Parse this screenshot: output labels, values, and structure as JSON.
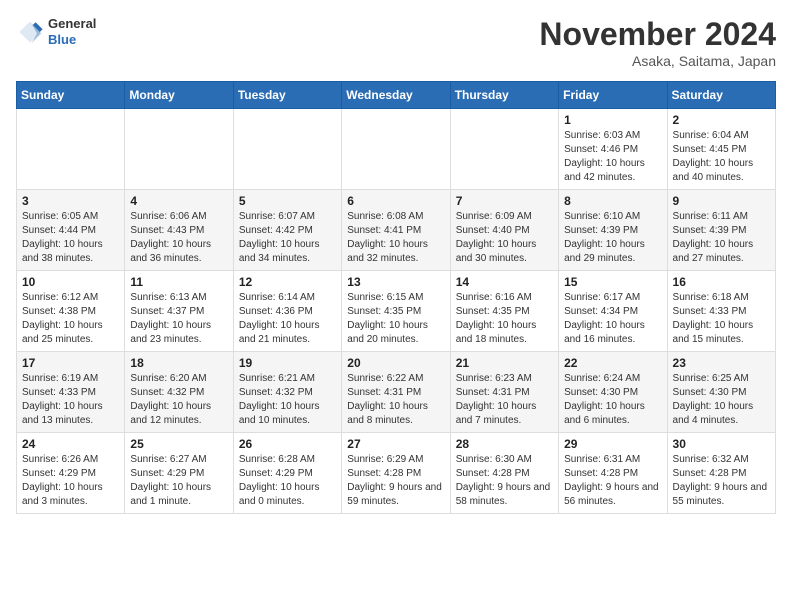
{
  "header": {
    "logo_general": "General",
    "logo_blue": "Blue",
    "month_title": "November 2024",
    "location": "Asaka, Saitama, Japan"
  },
  "days_of_week": [
    "Sunday",
    "Monday",
    "Tuesday",
    "Wednesday",
    "Thursday",
    "Friday",
    "Saturday"
  ],
  "weeks": [
    [
      {
        "day": "",
        "sunrise": "",
        "sunset": "",
        "daylight": ""
      },
      {
        "day": "",
        "sunrise": "",
        "sunset": "",
        "daylight": ""
      },
      {
        "day": "",
        "sunrise": "",
        "sunset": "",
        "daylight": ""
      },
      {
        "day": "",
        "sunrise": "",
        "sunset": "",
        "daylight": ""
      },
      {
        "day": "",
        "sunrise": "",
        "sunset": "",
        "daylight": ""
      },
      {
        "day": "1",
        "sunrise": "Sunrise: 6:03 AM",
        "sunset": "Sunset: 4:46 PM",
        "daylight": "Daylight: 10 hours and 42 minutes."
      },
      {
        "day": "2",
        "sunrise": "Sunrise: 6:04 AM",
        "sunset": "Sunset: 4:45 PM",
        "daylight": "Daylight: 10 hours and 40 minutes."
      }
    ],
    [
      {
        "day": "3",
        "sunrise": "Sunrise: 6:05 AM",
        "sunset": "Sunset: 4:44 PM",
        "daylight": "Daylight: 10 hours and 38 minutes."
      },
      {
        "day": "4",
        "sunrise": "Sunrise: 6:06 AM",
        "sunset": "Sunset: 4:43 PM",
        "daylight": "Daylight: 10 hours and 36 minutes."
      },
      {
        "day": "5",
        "sunrise": "Sunrise: 6:07 AM",
        "sunset": "Sunset: 4:42 PM",
        "daylight": "Daylight: 10 hours and 34 minutes."
      },
      {
        "day": "6",
        "sunrise": "Sunrise: 6:08 AM",
        "sunset": "Sunset: 4:41 PM",
        "daylight": "Daylight: 10 hours and 32 minutes."
      },
      {
        "day": "7",
        "sunrise": "Sunrise: 6:09 AM",
        "sunset": "Sunset: 4:40 PM",
        "daylight": "Daylight: 10 hours and 30 minutes."
      },
      {
        "day": "8",
        "sunrise": "Sunrise: 6:10 AM",
        "sunset": "Sunset: 4:39 PM",
        "daylight": "Daylight: 10 hours and 29 minutes."
      },
      {
        "day": "9",
        "sunrise": "Sunrise: 6:11 AM",
        "sunset": "Sunset: 4:39 PM",
        "daylight": "Daylight: 10 hours and 27 minutes."
      }
    ],
    [
      {
        "day": "10",
        "sunrise": "Sunrise: 6:12 AM",
        "sunset": "Sunset: 4:38 PM",
        "daylight": "Daylight: 10 hours and 25 minutes."
      },
      {
        "day": "11",
        "sunrise": "Sunrise: 6:13 AM",
        "sunset": "Sunset: 4:37 PM",
        "daylight": "Daylight: 10 hours and 23 minutes."
      },
      {
        "day": "12",
        "sunrise": "Sunrise: 6:14 AM",
        "sunset": "Sunset: 4:36 PM",
        "daylight": "Daylight: 10 hours and 21 minutes."
      },
      {
        "day": "13",
        "sunrise": "Sunrise: 6:15 AM",
        "sunset": "Sunset: 4:35 PM",
        "daylight": "Daylight: 10 hours and 20 minutes."
      },
      {
        "day": "14",
        "sunrise": "Sunrise: 6:16 AM",
        "sunset": "Sunset: 4:35 PM",
        "daylight": "Daylight: 10 hours and 18 minutes."
      },
      {
        "day": "15",
        "sunrise": "Sunrise: 6:17 AM",
        "sunset": "Sunset: 4:34 PM",
        "daylight": "Daylight: 10 hours and 16 minutes."
      },
      {
        "day": "16",
        "sunrise": "Sunrise: 6:18 AM",
        "sunset": "Sunset: 4:33 PM",
        "daylight": "Daylight: 10 hours and 15 minutes."
      }
    ],
    [
      {
        "day": "17",
        "sunrise": "Sunrise: 6:19 AM",
        "sunset": "Sunset: 4:33 PM",
        "daylight": "Daylight: 10 hours and 13 minutes."
      },
      {
        "day": "18",
        "sunrise": "Sunrise: 6:20 AM",
        "sunset": "Sunset: 4:32 PM",
        "daylight": "Daylight: 10 hours and 12 minutes."
      },
      {
        "day": "19",
        "sunrise": "Sunrise: 6:21 AM",
        "sunset": "Sunset: 4:32 PM",
        "daylight": "Daylight: 10 hours and 10 minutes."
      },
      {
        "day": "20",
        "sunrise": "Sunrise: 6:22 AM",
        "sunset": "Sunset: 4:31 PM",
        "daylight": "Daylight: 10 hours and 8 minutes."
      },
      {
        "day": "21",
        "sunrise": "Sunrise: 6:23 AM",
        "sunset": "Sunset: 4:31 PM",
        "daylight": "Daylight: 10 hours and 7 minutes."
      },
      {
        "day": "22",
        "sunrise": "Sunrise: 6:24 AM",
        "sunset": "Sunset: 4:30 PM",
        "daylight": "Daylight: 10 hours and 6 minutes."
      },
      {
        "day": "23",
        "sunrise": "Sunrise: 6:25 AM",
        "sunset": "Sunset: 4:30 PM",
        "daylight": "Daylight: 10 hours and 4 minutes."
      }
    ],
    [
      {
        "day": "24",
        "sunrise": "Sunrise: 6:26 AM",
        "sunset": "Sunset: 4:29 PM",
        "daylight": "Daylight: 10 hours and 3 minutes."
      },
      {
        "day": "25",
        "sunrise": "Sunrise: 6:27 AM",
        "sunset": "Sunset: 4:29 PM",
        "daylight": "Daylight: 10 hours and 1 minute."
      },
      {
        "day": "26",
        "sunrise": "Sunrise: 6:28 AM",
        "sunset": "Sunset: 4:29 PM",
        "daylight": "Daylight: 10 hours and 0 minutes."
      },
      {
        "day": "27",
        "sunrise": "Sunrise: 6:29 AM",
        "sunset": "Sunset: 4:28 PM",
        "daylight": "Daylight: 9 hours and 59 minutes."
      },
      {
        "day": "28",
        "sunrise": "Sunrise: 6:30 AM",
        "sunset": "Sunset: 4:28 PM",
        "daylight": "Daylight: 9 hours and 58 minutes."
      },
      {
        "day": "29",
        "sunrise": "Sunrise: 6:31 AM",
        "sunset": "Sunset: 4:28 PM",
        "daylight": "Daylight: 9 hours and 56 minutes."
      },
      {
        "day": "30",
        "sunrise": "Sunrise: 6:32 AM",
        "sunset": "Sunset: 4:28 PM",
        "daylight": "Daylight: 9 hours and 55 minutes."
      }
    ]
  ]
}
